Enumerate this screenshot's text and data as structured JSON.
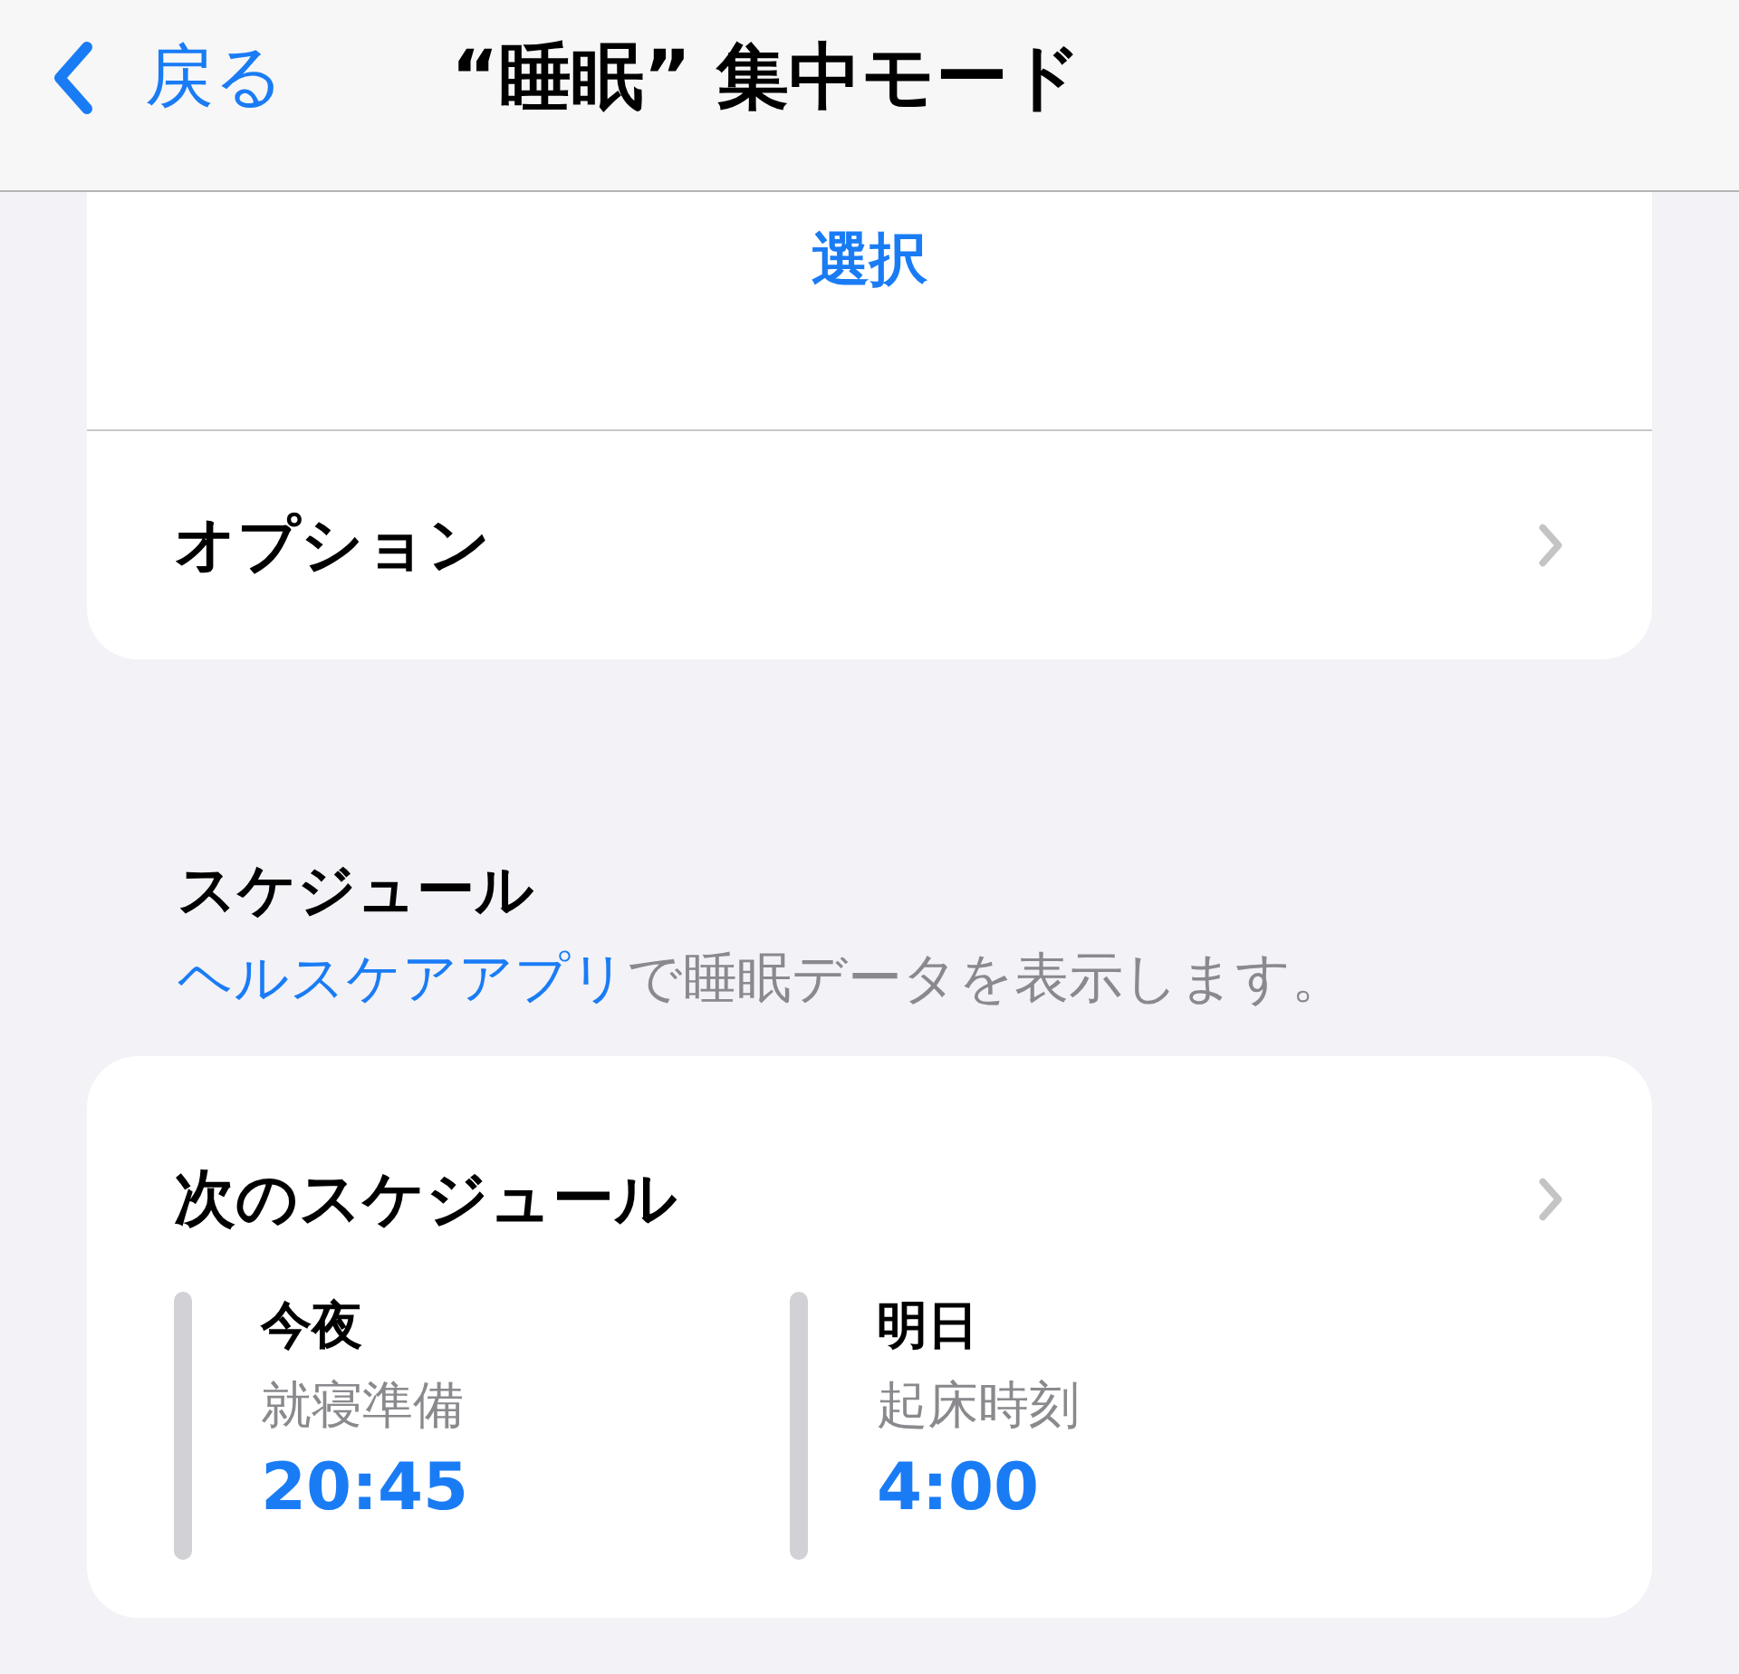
{
  "nav": {
    "back": "戻る",
    "title": "“睡眠” 集中モード"
  },
  "top_card": {
    "select": "選択",
    "rows": [
      {
        "label": "オプション"
      }
    ]
  },
  "schedule_section": {
    "header": "スケジュール",
    "note_link": "ヘルスケアアプリ",
    "note_text": "で睡眠データを表示します。"
  },
  "schedule_card": {
    "title": "次のスケジュール",
    "items": [
      {
        "day": "今夜",
        "label": "就寝準備",
        "time": "20:45"
      },
      {
        "day": "明日",
        "label": "起床時刻",
        "time": "4:00"
      }
    ]
  }
}
